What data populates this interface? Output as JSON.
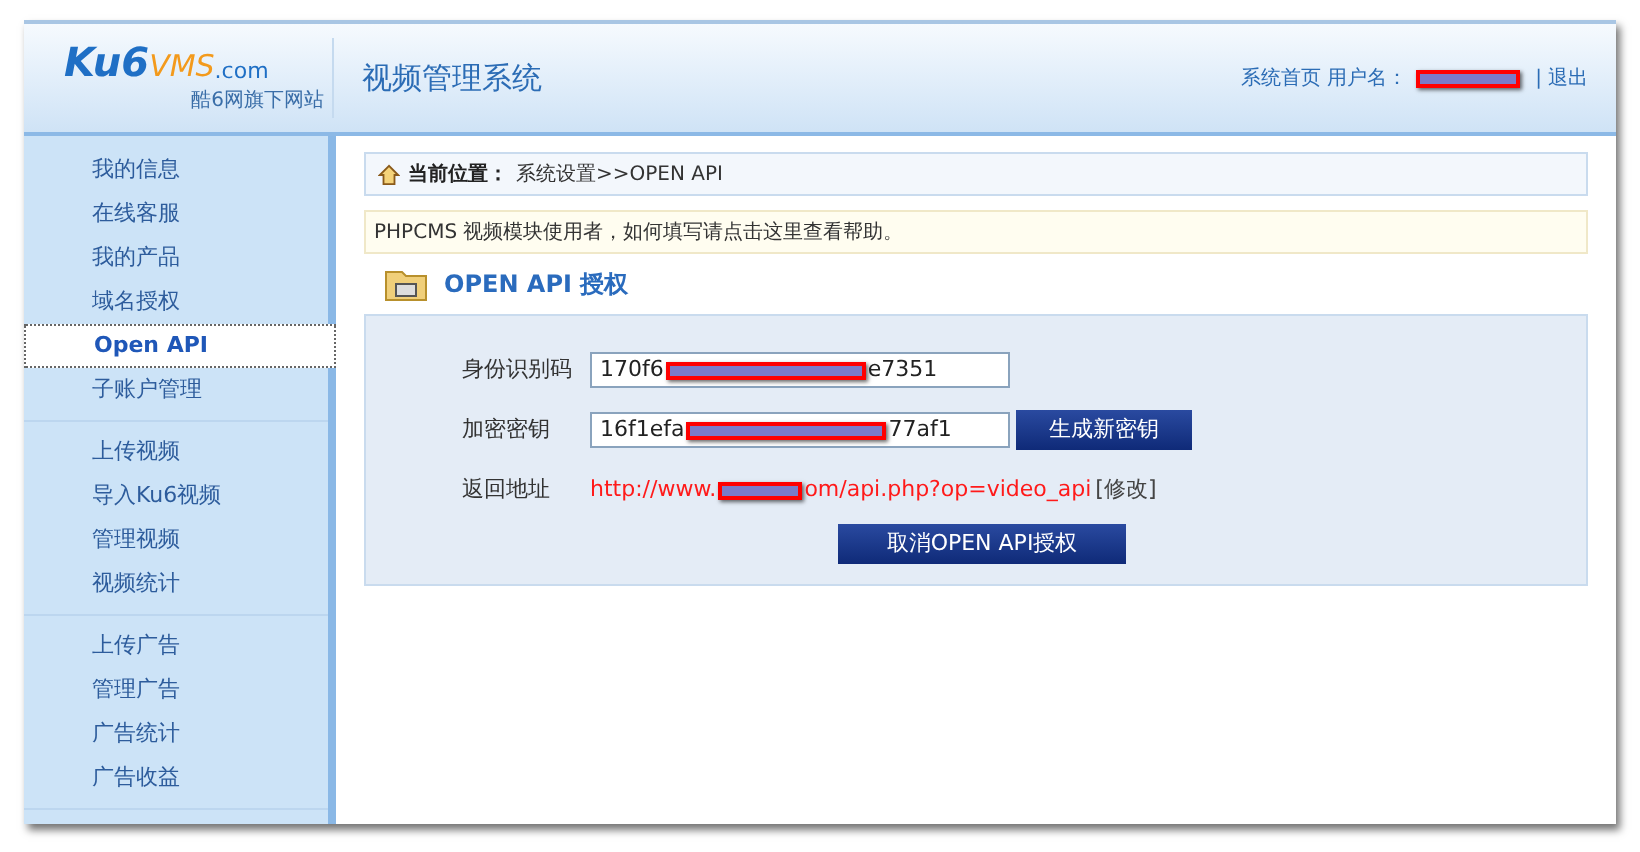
{
  "header": {
    "logo_text": "Ku6",
    "logo_text_2": "VMS",
    "logo_domain": ".com",
    "logo_tagline": "酷6网旗下网站",
    "title": "视频管理系统",
    "links": [
      {
        "label": "系统首页"
      }
    ],
    "user_label": "用户名：",
    "separator": "|",
    "logout": "退出"
  },
  "sidebar": {
    "groups": [
      {
        "items": [
          {
            "label": "我的信息",
            "selected": false
          },
          {
            "label": "在线客服",
            "selected": false
          },
          {
            "label": "我的产品",
            "selected": false
          },
          {
            "label": "域名授权",
            "selected": false
          },
          {
            "label": "Open API",
            "selected": true
          },
          {
            "label": "子账户管理",
            "selected": false
          }
        ]
      },
      {
        "items": [
          {
            "label": "上传视频",
            "selected": false
          },
          {
            "label": "导入Ku6视频",
            "selected": false
          },
          {
            "label": "管理视频",
            "selected": false
          },
          {
            "label": "视频统计",
            "selected": false
          }
        ]
      },
      {
        "items": [
          {
            "label": "上传广告",
            "selected": false
          },
          {
            "label": "管理广告",
            "selected": false
          },
          {
            "label": "广告统计",
            "selected": false
          },
          {
            "label": "广告收益",
            "selected": false
          }
        ]
      }
    ]
  },
  "breadcrumb": {
    "label": "当前位置：",
    "path": "系统设置>>OPEN API"
  },
  "notice": "PHPCMS 视频模块使用者，如何填写请点击这里查看帮助。",
  "section_title": "OPEN API 授权",
  "form": {
    "rows": [
      {
        "kind": "field",
        "label": "身份识别码",
        "value_start": "170f6",
        "value_end": "e7351"
      },
      {
        "kind": "field_button",
        "label": "加密密钥",
        "value_start": "16f1efa",
        "value_end": "77af1",
        "button": "生成新密钥"
      },
      {
        "kind": "link",
        "label": "返回地址",
        "url_start": "http://www.",
        "url_end": "om/api.php?op=video_api",
        "edit": "[修改]"
      }
    ],
    "submit": "取消OPEN API授权"
  }
}
